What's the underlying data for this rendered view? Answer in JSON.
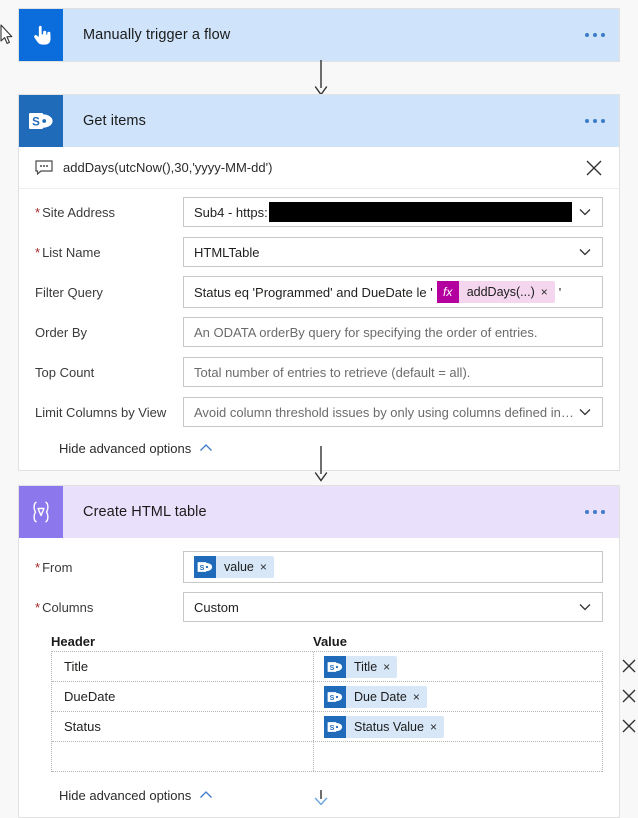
{
  "flow": {
    "steps": [
      {
        "id": "trigger",
        "title": "Manually trigger a flow",
        "icon": "hand-pointer-icon",
        "icon_color": "#0b6ddb",
        "header_color": "#cfe4fa",
        "menu": "..."
      },
      {
        "id": "get-items",
        "title": "Get items",
        "icon": "sharepoint-icon",
        "icon_color": "#1f6bba",
        "header_color": "#cfe4fa",
        "menu": "...",
        "expression_tooltip": {
          "icon": "tooltip-icon",
          "text": "addDays(utcNow(),30,'yyyy-MM-dd')",
          "close": "×"
        },
        "fields": [
          {
            "label": "Site Address",
            "required": true,
            "value": "Sub4 - https:",
            "redacted": true,
            "control": "dropdown"
          },
          {
            "label": "List Name",
            "required": true,
            "value": "HTMLTable",
            "control": "dropdown"
          },
          {
            "label": "Filter Query",
            "required": false,
            "control": "token-input",
            "prefix": "Status eq 'Programmed' and DueDate le '",
            "token": {
              "badge": "fx",
              "label": "addDays(...)",
              "remove": "×"
            },
            "suffix": "'"
          },
          {
            "label": "Order By",
            "required": false,
            "placeholder": "An ODATA orderBy query for specifying the order of entries.",
            "control": "text"
          },
          {
            "label": "Top Count",
            "required": false,
            "placeholder": "Total number of entries to retrieve (default = all).",
            "control": "text"
          },
          {
            "label": "Limit Columns by View",
            "required": false,
            "placeholder": "Avoid column threshold issues by only using columns defined in a view",
            "control": "dropdown"
          }
        ],
        "advanced_label": "Hide advanced options"
      },
      {
        "id": "create-html-table",
        "title": "Create HTML table",
        "icon": "data-operation-icon",
        "icon_color": "#8c78ec",
        "header_color": "#e9e1fb",
        "menu": "...",
        "fields": [
          {
            "label": "From",
            "required": true,
            "control": "token-input",
            "token": {
              "badge": "sharepoint-icon",
              "label": "value",
              "remove": "×"
            }
          },
          {
            "label": "Columns",
            "required": true,
            "value": "Custom",
            "control": "dropdown"
          }
        ],
        "columns_grid": {
          "headers": [
            "Header",
            "Value"
          ],
          "rows": [
            {
              "header": "Title",
              "value_token": {
                "badge": "sharepoint-icon",
                "label": "Title",
                "remove": "×"
              },
              "delete": "×"
            },
            {
              "header": "DueDate",
              "value_token": {
                "badge": "sharepoint-icon",
                "label": "Due Date",
                "remove": "×"
              },
              "delete": "×"
            },
            {
              "header": "Status",
              "value_token": {
                "badge": "sharepoint-icon",
                "label": "Status Value",
                "remove": "×"
              },
              "delete": "×"
            },
            {
              "header": "",
              "value_token": null,
              "delete": ""
            }
          ]
        },
        "advanced_label": "Hide advanced options"
      }
    ]
  },
  "colors": {
    "trigger_blue": "#0b6ddb",
    "sharepoint_blue": "#1f6bba",
    "dataop_purple": "#8c78ec",
    "header_blue": "#cfe4fa",
    "header_purple": "#e9e1fb",
    "required_red": "#a4262c",
    "fx_magenta": "#b4009e",
    "fx_pill": "#f4d7ef",
    "sp_pill": "#d7e7f7",
    "canvas": "#f8f8f8"
  }
}
